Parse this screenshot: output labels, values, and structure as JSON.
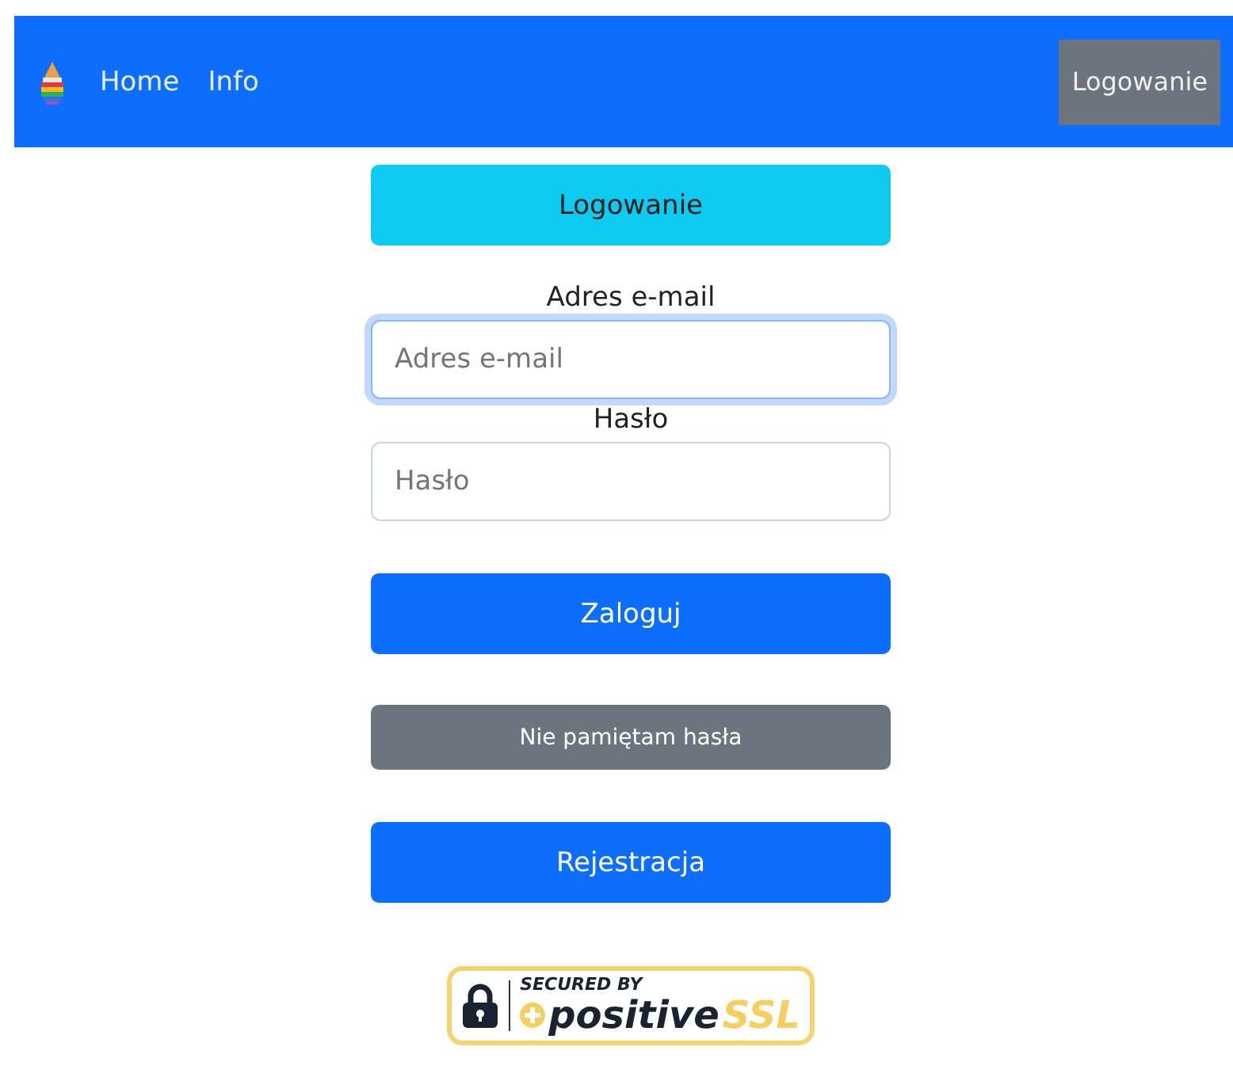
{
  "navbar": {
    "links": [
      {
        "label": "Home"
      },
      {
        "label": "Info"
      }
    ],
    "login_button": "Logowanie"
  },
  "form": {
    "title_button": "Logowanie",
    "fields": [
      {
        "label": "Adres e-mail",
        "placeholder": "Adres e-mail",
        "focused": true
      },
      {
        "label": "Hasło",
        "placeholder": "Hasło",
        "focused": false
      }
    ],
    "buttons": [
      {
        "label": "Zaloguj",
        "kind": "primary"
      },
      {
        "label": "Nie pamiętam hasła",
        "kind": "secondary"
      },
      {
        "label": "Rejestracja",
        "kind": "primary"
      }
    ]
  },
  "ssl_badge": {
    "caption": "SECURED BY",
    "brand": "positive",
    "brand_suffix": "SSL"
  }
}
